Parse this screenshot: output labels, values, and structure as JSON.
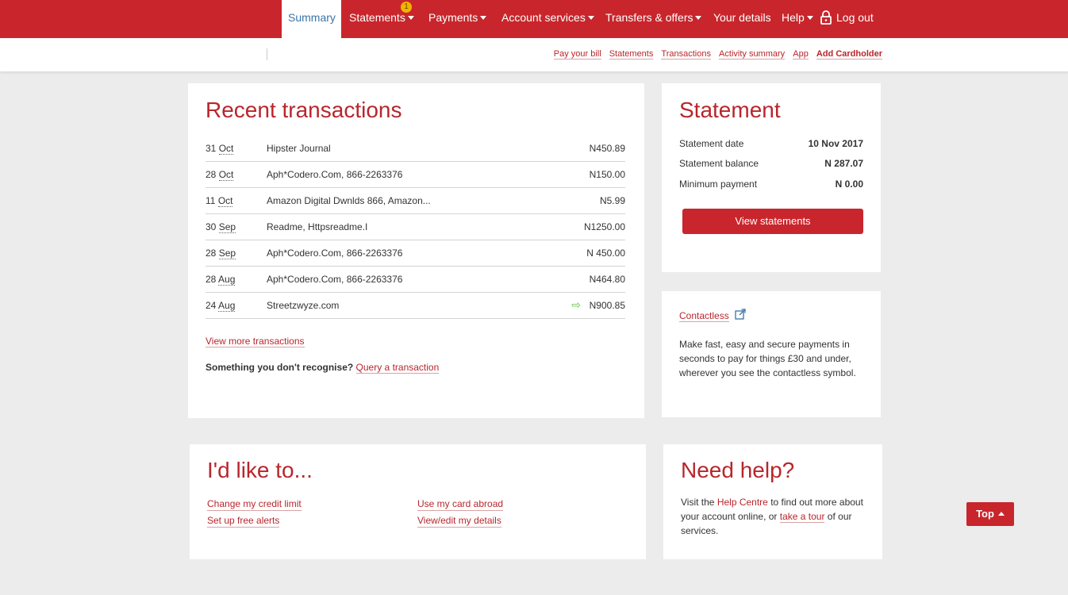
{
  "colors": {
    "brand": "#c8262c",
    "active_tab_text": "#3a73a8",
    "positive_arrow": "#6bbf45"
  },
  "nav": {
    "summary": "Summary",
    "statements": "Statements",
    "statements_badge": "1",
    "payments": "Payments",
    "account_services": "Account services",
    "transfers": "Transfers & offers",
    "your_details": "Your details",
    "help": "Help",
    "logout": "Log out"
  },
  "subnav": {
    "pay_bill": "Pay your bill",
    "statements": "Statements",
    "transactions": "Transactions",
    "activity": "Activity summary",
    "app": "App",
    "add_cardholder": "Add Cardholder"
  },
  "recent": {
    "title": "Recent transactions",
    "rows": [
      {
        "day": "31",
        "month": "Oct",
        "desc": "Hipster Journal",
        "amount": "N450.89"
      },
      {
        "day": "28",
        "month": "Oct",
        "desc": "Aph*Codero.Com, 866-2263376",
        "amount": "N150.00"
      },
      {
        "day": "11",
        "month": "Oct",
        "desc": "Amazon Digital Dwnlds 866, Amazon...",
        "amount": "N5.99"
      },
      {
        "day": "30",
        "month": "Sep",
        "desc": "Readme, Httpsreadme.I",
        "amount": "N1250.00"
      },
      {
        "day": "28",
        "month": "Sep",
        "desc": "Aph*Codero.Com, 866-2263376",
        "amount": "N 450.00"
      },
      {
        "day": "28",
        "month": "Aug",
        "desc": "Aph*Codero.Com, 866-2263376",
        "amount": "N464.80"
      },
      {
        "day": "24",
        "month": "Aug",
        "desc": "Streetzwyze.com",
        "amount": "N900.85"
      }
    ],
    "arrow_glyph": "⇨",
    "view_more": "View more transactions",
    "query_prompt": "Something you don't recognise?",
    "query_link": "Query a transaction"
  },
  "statement": {
    "title": "Statement",
    "date_label": "Statement date",
    "date_value": "10 Nov 2017",
    "balance_label": "Statement balance",
    "balance_value": "N 287.07",
    "min_label": "Minimum payment",
    "min_value": "N 0.00",
    "button": "View statements"
  },
  "contactless": {
    "link": "Contactless",
    "text": "Make fast, easy and secure payments in seconds to pay for things £30 and under, wherever you see the contactless symbol."
  },
  "like": {
    "title": "I'd like to...",
    "credit_limit": "Change my credit limit",
    "alerts": "Set up free alerts",
    "abroad": "Use my card abroad",
    "details": "View/edit my details"
  },
  "help": {
    "title": "Need help?",
    "text_1": "Visit the",
    "help_centre": "Help Centre",
    "text_2": "to find out more about your account online, or",
    "tour": "take a tour",
    "text_3": "of our services."
  },
  "top_button": "Top"
}
